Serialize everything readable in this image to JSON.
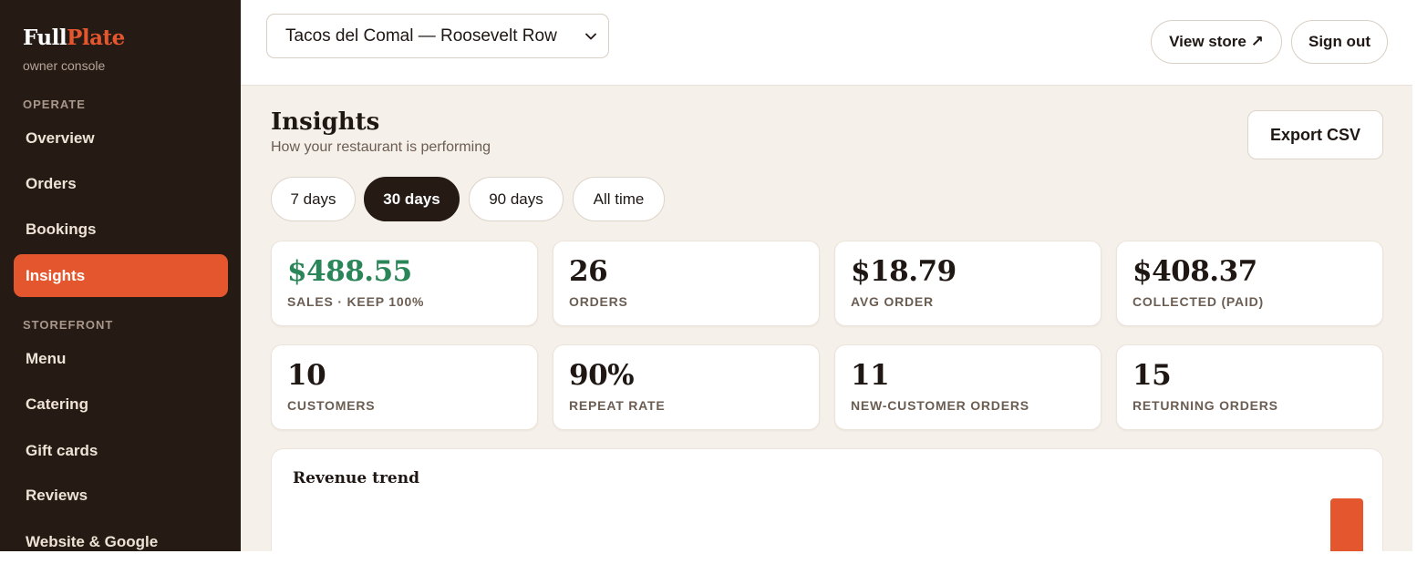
{
  "brand": {
    "part1": "Full",
    "part2": "Plate",
    "subtitle": "owner console"
  },
  "sidebar": {
    "sections": [
      {
        "label": "OPERATE",
        "items": [
          {
            "label": "Overview"
          },
          {
            "label": "Orders"
          },
          {
            "label": "Bookings"
          },
          {
            "label": "Insights",
            "active": true
          }
        ]
      },
      {
        "label": "STOREFRONT",
        "items": [
          {
            "label": "Menu"
          },
          {
            "label": "Catering"
          },
          {
            "label": "Gift cards"
          },
          {
            "label": "Reviews"
          },
          {
            "label": "Website & Google"
          }
        ]
      }
    ]
  },
  "topbar": {
    "store_selected": "Tacos del Comal — Roosevelt Row",
    "view_store": "View store ↗",
    "sign_out": "Sign out"
  },
  "page": {
    "title": "Insights",
    "subtitle": "How your restaurant is performing",
    "export": "Export CSV",
    "ranges": [
      {
        "label": "7 days"
      },
      {
        "label": "30 days",
        "active": true
      },
      {
        "label": "90 days"
      },
      {
        "label": "All time"
      }
    ]
  },
  "stats": [
    {
      "value": "$488.55",
      "label": "SALES · KEEP 100%",
      "accent": "#2a8658"
    },
    {
      "value": "26",
      "label": "ORDERS"
    },
    {
      "value": "$18.79",
      "label": "AVG ORDER"
    },
    {
      "value": "$408.37",
      "label": "COLLECTED (PAID)"
    },
    {
      "value": "10",
      "label": "CUSTOMERS"
    },
    {
      "value": "90%",
      "label": "REPEAT RATE"
    },
    {
      "value": "11",
      "label": "NEW-CUSTOMER ORDERS"
    },
    {
      "value": "15",
      "label": "RETURNING ORDERS"
    }
  ],
  "chart": {
    "title": "Revenue trend",
    "bar_color": "#e4572e"
  },
  "colors": {
    "accent": "#e4572e",
    "sidebar_bg": "#251a14",
    "positive": "#2a8658",
    "page_bg": "#f5f0ea"
  },
  "icons": {
    "select_chevron": "chevron-down-icon"
  }
}
